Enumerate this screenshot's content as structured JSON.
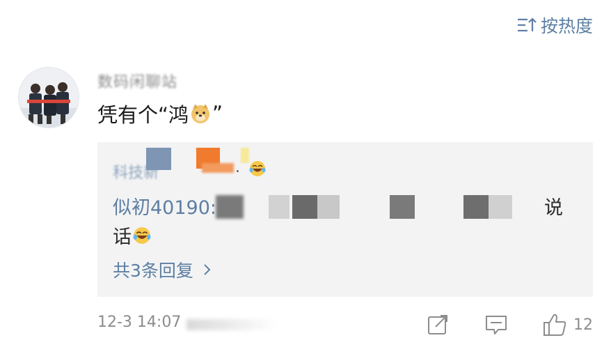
{
  "sort": {
    "label": "按热度",
    "icon": "sort-lines-icon"
  },
  "comment": {
    "avatar_icon": "group-photo-avatar",
    "username": "数码闲聊站",
    "text": "凭有个“鸿",
    "text_end": "”",
    "emoji": "doge-emoji"
  },
  "reply": {
    "first_line_name": "科技新",
    "first_line_dot": ".",
    "first_line_emoji": "laugh-cry-emoji",
    "nick": "似初40190:",
    "text_tail": "说",
    "line2": "话",
    "line2_emoji": "laugh-cry-emoji",
    "more_label": "共3条回复",
    "more_icon": "chevron-right-icon"
  },
  "footer": {
    "time": "12-3 14:07",
    "share_icon": "share-icon",
    "comment_icon": "comment-icon",
    "like_icon": "thumbs-up-icon",
    "like_count": "12"
  },
  "colors": {
    "link": "#5d7fa3",
    "reply_bg": "#f3f3f4",
    "muted": "#8c8c8c"
  }
}
